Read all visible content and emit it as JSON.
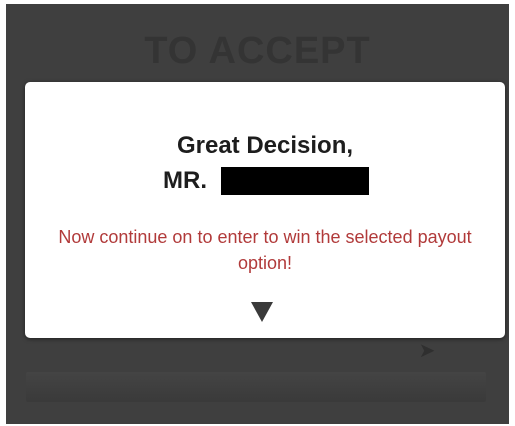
{
  "background": {
    "heading": "TO ACCEPT"
  },
  "modal": {
    "title": "Great Decision,",
    "name_prefix": "MR.",
    "message": "Now continue on to enter to win the selected payout option!"
  },
  "icons": {
    "continue": "triangle-down-icon",
    "backdrop_arrow": "cursor-arrow-icon"
  },
  "colors": {
    "backdrop": "#3f3f3f",
    "modal_bg": "#ffffff",
    "title_text": "#1d1d1d",
    "message_text": "#b13a3a",
    "redaction": "#000000",
    "arrow": "#3a3a3a"
  }
}
